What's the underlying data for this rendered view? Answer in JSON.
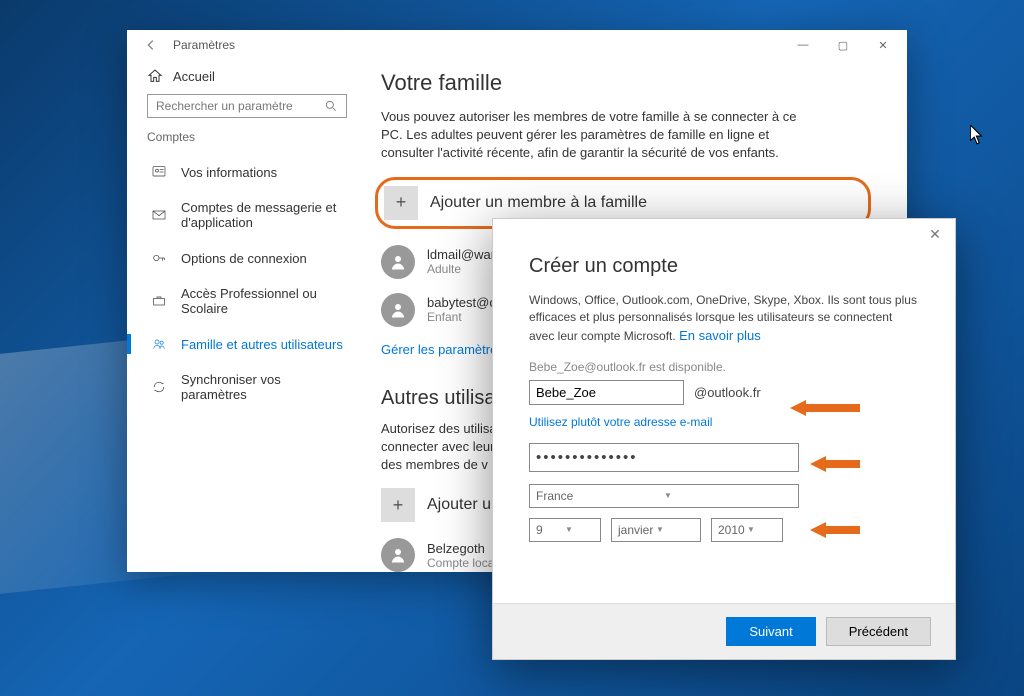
{
  "window": {
    "title": "Paramètres",
    "home": "Accueil",
    "search_placeholder": "Rechercher un paramètre",
    "category": "Comptes",
    "nav": [
      {
        "label": "Vos informations"
      },
      {
        "label": "Comptes de messagerie et d'application"
      },
      {
        "label": "Options de connexion"
      },
      {
        "label": "Accès Professionnel ou Scolaire"
      },
      {
        "label": "Famille et autres utilisateurs"
      },
      {
        "label": "Synchroniser vos paramètres"
      }
    ]
  },
  "family": {
    "title": "Votre famille",
    "desc": "Vous pouvez autoriser les membres de votre famille à se connecter à ce PC. Les adultes peuvent gérer les paramètres de famille en ligne et consulter l'activité récente, afin de garantir la sécurité de vos enfants.",
    "add_member": "Ajouter un membre à la famille",
    "members": [
      {
        "email": "ldmail@wanado",
        "role": "Adulte"
      },
      {
        "email": "babytest@outlo",
        "role": "Enfant"
      }
    ],
    "manage_link": "Gérer les paramètres de"
  },
  "other": {
    "title": "Autres utilisate",
    "desc": "Autorisez des utilisateurs connecter avec leur pro liste des membres de v",
    "add": "Ajouter un autre",
    "local": {
      "name": "Belzegoth",
      "type": "Compte local"
    }
  },
  "dialog": {
    "title": "Créer un compte",
    "desc": "Windows, Office, Outlook.com, OneDrive, Skype, Xbox. Ils sont tous plus efficaces et plus personnalisés lorsque les utilisateurs se connectent avec leur compte Microsoft. ",
    "learn_more": "En savoir plus",
    "available": "Bebe_Zoe@outlook.fr est disponible.",
    "username": "Bebe_Zoe",
    "domain": "@outlook.fr",
    "use_email": "Utilisez plutôt votre adresse e-mail",
    "password_masked": "••••••••••••••",
    "country": "France",
    "dob": {
      "day": "9",
      "month": "janvier",
      "year": "2010"
    },
    "primary": "Suivant",
    "secondary": "Précédent"
  }
}
